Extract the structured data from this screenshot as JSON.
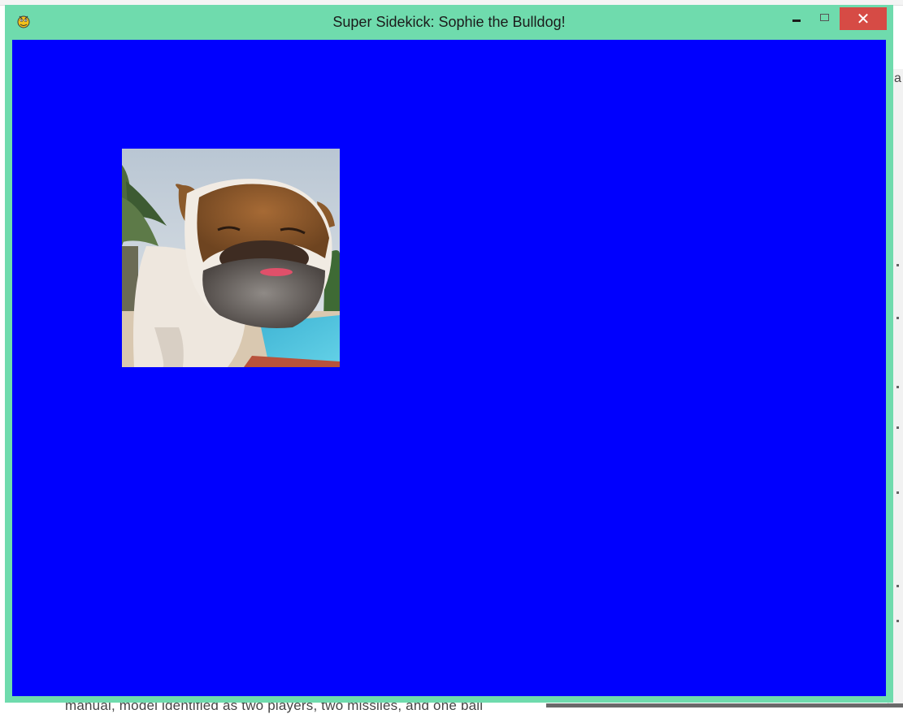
{
  "window": {
    "title": "Super Sidekick: Sophie the Bulldog!",
    "app_icon": "pygame-snake-icon",
    "controls": {
      "minimize_icon": "minimize-icon",
      "maximize_icon": "maximize-icon",
      "close_label": "✕"
    },
    "frame_color": "#6fdbad",
    "close_color": "#d64b45"
  },
  "canvas": {
    "background_color": "#0000fe",
    "sprite": {
      "subject": "bulldog-photo"
    }
  },
  "background": {
    "right_letter": "a",
    "bottom_text": "manual, model identified as two players, two missiles, and one ball"
  }
}
